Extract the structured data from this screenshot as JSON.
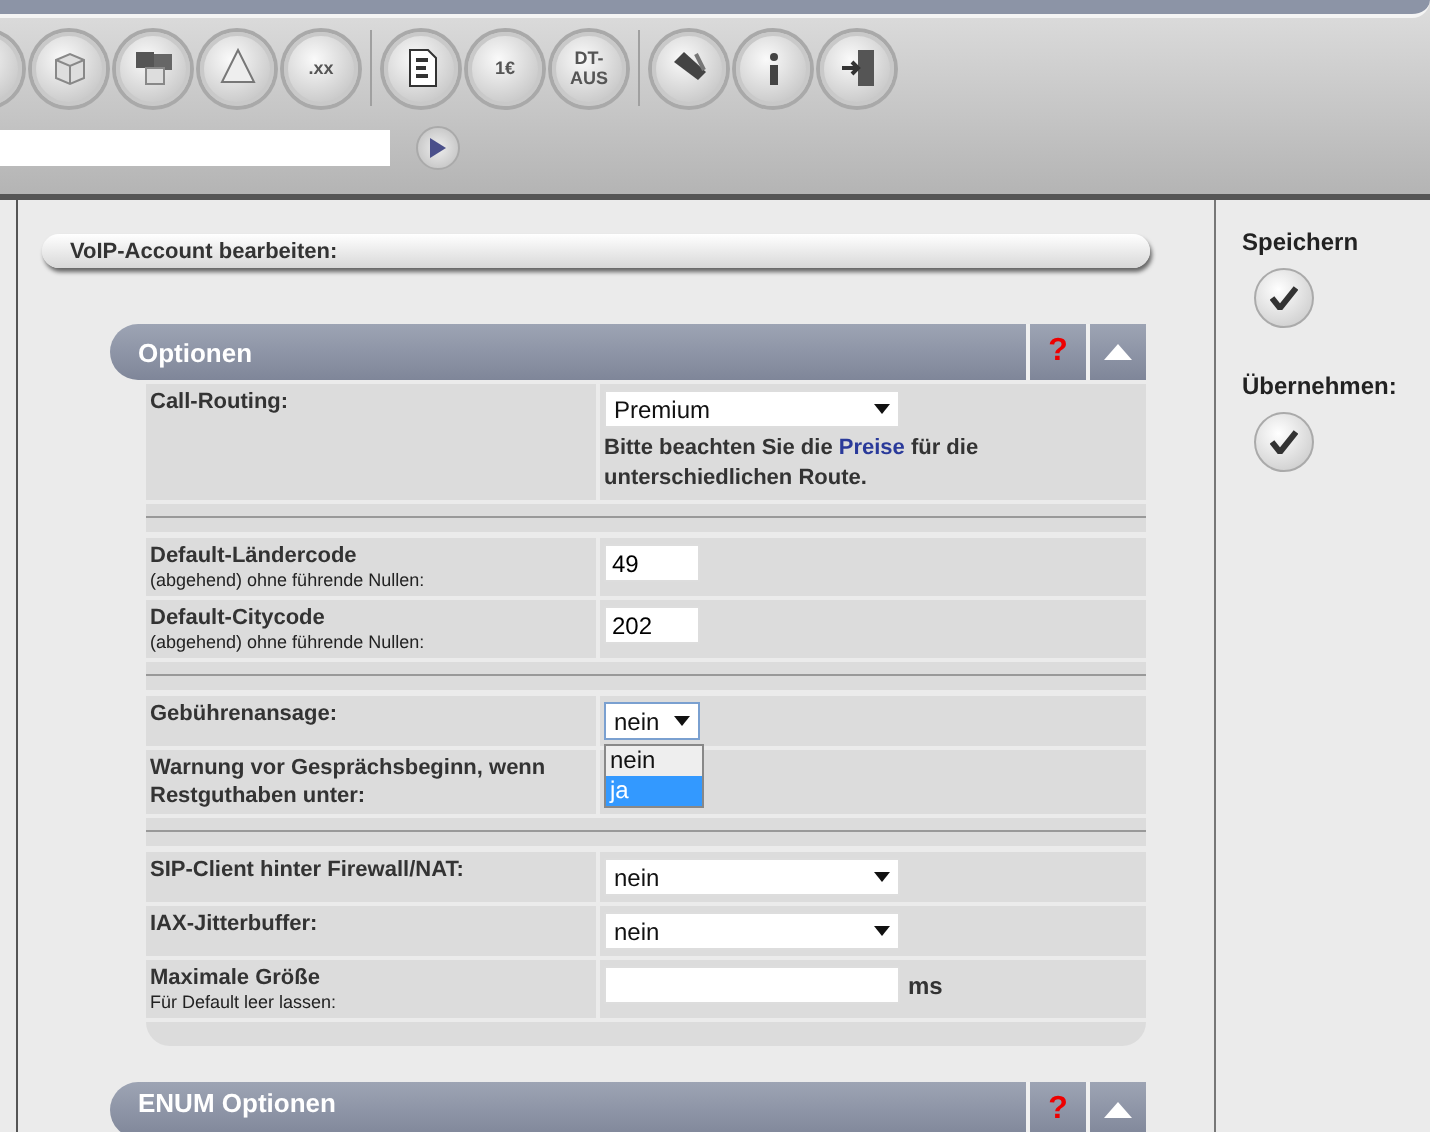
{
  "toolbar": {
    "buttons": [
      {
        "kind": "blank"
      },
      {
        "kind": "cube"
      },
      {
        "kind": "cubes"
      },
      {
        "kind": "pyramid"
      },
      {
        "kind": "domain",
        "label": ".xx"
      },
      {
        "kind": "divider"
      },
      {
        "kind": "document"
      },
      {
        "kind": "invoice",
        "label": "1€"
      },
      {
        "kind": "text",
        "label": "DT-",
        "label2": "AUS"
      },
      {
        "kind": "divider"
      },
      {
        "kind": "tools"
      },
      {
        "kind": "info"
      },
      {
        "kind": "exit"
      }
    ]
  },
  "title_bar": {
    "title": "VoIP-Account bearbeiten:"
  },
  "panel": {
    "title": "Optionen",
    "help": "?",
    "expanded": true,
    "groups": [
      [
        {
          "kind": "select",
          "label": "Call-Routing:",
          "value": "Premium",
          "note": {
            "before": "Bitte beachten Sie die ",
            "link": "Preise",
            "after": " für die unterschiedlichen Route."
          }
        }
      ],
      [
        {
          "kind": "input-short",
          "label": "Default-Ländercode",
          "hint": "(abgehend) ohne führende Nullen:",
          "value": "49"
        },
        {
          "kind": "input-short",
          "label": "Default-Citycode",
          "hint": "(abgehend) ohne führende Nullen:",
          "value": "202"
        }
      ],
      [
        {
          "kind": "select-short",
          "label": "Gebührenansage:",
          "value": "nein",
          "open": true,
          "options": [
            {
              "label": "nein",
              "highlighted": false
            },
            {
              "label": "ja",
              "highlighted": true
            }
          ]
        },
        {
          "kind": "empty",
          "label": "Warnung vor Gesprächsbeginn, wenn Restguthaben unter:"
        }
      ],
      [
        {
          "kind": "select",
          "label": "SIP-Client hinter Firewall/NAT:",
          "value": "nein"
        },
        {
          "kind": "select",
          "label": "IAX-Jitterbuffer:",
          "value": "nein"
        },
        {
          "kind": "input",
          "label": "Maximale Größe",
          "hint": "Für Default leer lassen:",
          "unit": "ms"
        }
      ]
    ]
  },
  "next_panel": {
    "title": "ENUM Optionen",
    "help": "?",
    "expanded": true
  },
  "actions": [
    {
      "label": "Speichern"
    },
    {
      "label": "Übernehmen:"
    }
  ]
}
